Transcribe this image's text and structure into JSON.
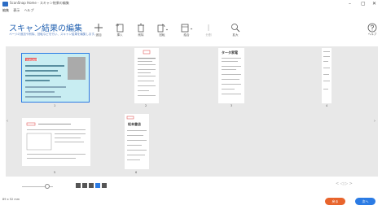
{
  "window": {
    "title": "ScanSnap Home - スキャン結果の編集",
    "minimize": "–",
    "maximize": "▢",
    "close": "✕"
  },
  "menu": [
    "編集",
    "表示",
    "ヘルプ"
  ],
  "header": {
    "title": "スキャン結果の編集",
    "subtitle": "ページの追加や削除、回転などを行い、スキャン結果を編集します。"
  },
  "toolbar": [
    {
      "label": "追加",
      "icon": "plus-icon",
      "enabled": true
    },
    {
      "label": "挿入",
      "icon": "insert-page-icon",
      "enabled": true
    },
    {
      "label": "削除",
      "icon": "trash-icon",
      "enabled": true
    },
    {
      "label": "回転",
      "icon": "rotate-icon",
      "enabled": true
    },
    {
      "label": "結合",
      "icon": "merge-icon",
      "enabled": true
    },
    {
      "label": "分割",
      "icon": "split-icon",
      "enabled": false
    },
    {
      "label": "拡大",
      "icon": "magnifier-icon",
      "enabled": true
    }
  ],
  "help_label": "ヘルプ",
  "thumbnails": [
    {
      "page": "1",
      "selected": true,
      "header_text": "普通自動車",
      "kind": "card"
    },
    {
      "page": "2",
      "selected": false,
      "header_text": "領収書",
      "kind": "receipt"
    },
    {
      "page": "3",
      "selected": false,
      "header_text": "タータ家電",
      "kind": "receipt"
    },
    {
      "page": "4",
      "selected": false,
      "header_text": "",
      "kind": "receipt"
    },
    {
      "page": "5",
      "selected": false,
      "header_text": "",
      "kind": "document"
    },
    {
      "page": "6",
      "selected": false,
      "header_text": "松本書店",
      "kind": "receipt"
    }
  ],
  "status_text": "89 x 52 mm",
  "page_nav": "< ◁ ▷ >",
  "buttons": {
    "back": "戻る",
    "next": "次へ"
  },
  "colors": {
    "accent": "#2b7be4",
    "title": "#1f5fb0",
    "back_button": "#e8642c",
    "next_button": "#2b7be4"
  }
}
